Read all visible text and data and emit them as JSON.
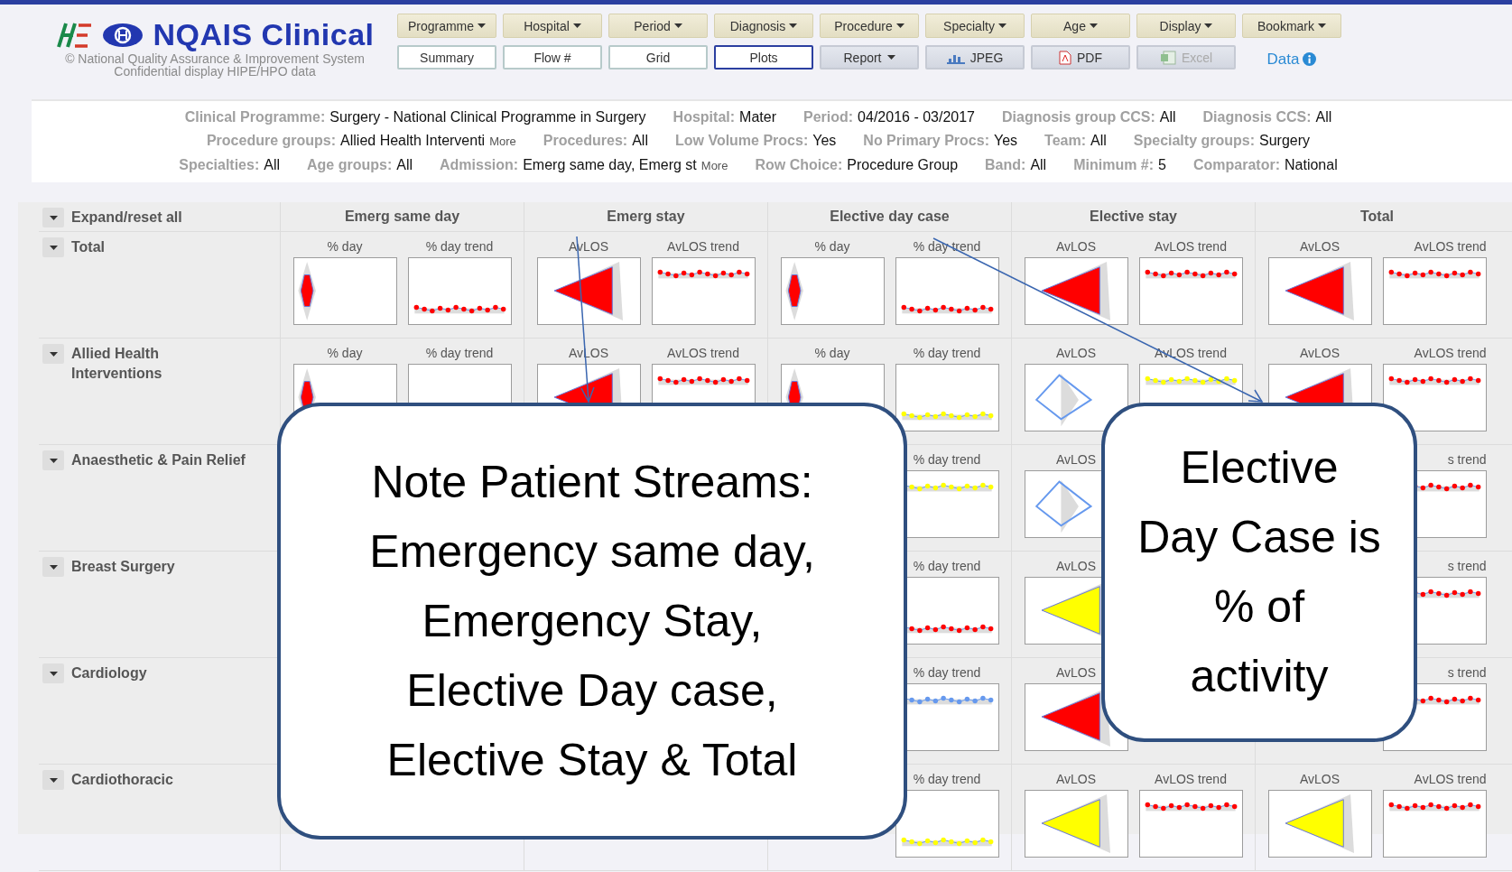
{
  "header": {
    "title": "NQAIS Clinical",
    "subtitle": [
      "© National Quality Assurance & Improvement System",
      "Confidential display HIPE/HPO data"
    ],
    "menus": [
      {
        "label": "Programme"
      },
      {
        "label": "Hospital"
      },
      {
        "label": "Period"
      },
      {
        "label": "Diagnosis"
      },
      {
        "label": "Procedure"
      },
      {
        "label": "Specialty"
      },
      {
        "label": "Age"
      },
      {
        "label": "Display"
      },
      {
        "label": "Bookmark"
      }
    ],
    "views": [
      {
        "label": "Summary",
        "kind": "view",
        "selected": false,
        "disabled": false
      },
      {
        "label": "Flow #",
        "kind": "view",
        "selected": false,
        "disabled": false
      },
      {
        "label": "Grid",
        "kind": "view",
        "selected": false,
        "disabled": false
      },
      {
        "label": "Plots",
        "kind": "view",
        "selected": true,
        "disabled": false
      },
      {
        "label": "Report",
        "kind": "menu",
        "selected": false,
        "disabled": false
      },
      {
        "label": "JPEG",
        "kind": "image",
        "selected": false,
        "disabled": false
      },
      {
        "label": "PDF",
        "kind": "pdf",
        "selected": false,
        "disabled": false
      },
      {
        "label": "Excel",
        "kind": "spreadsheet",
        "selected": false,
        "disabled": true
      }
    ],
    "data_link": "Data"
  },
  "filters": [
    [
      {
        "label": "Clinical Programme:",
        "value": "Surgery - National Clinical Programme in Surgery"
      },
      {
        "label": "Hospital:",
        "value": "Mater"
      },
      {
        "label": "Period:",
        "value": "04/2016 - 03/2017"
      },
      {
        "label": "Diagnosis group CCS:",
        "value": "All"
      },
      {
        "label": "Diagnosis CCS:",
        "value": "All"
      }
    ],
    [
      {
        "label": "Procedure groups:",
        "value": "Allied Health Interventi",
        "more": "More"
      },
      {
        "label": "Procedures:",
        "value": "All"
      },
      {
        "label": "Low Volume Procs:",
        "value": "Yes"
      },
      {
        "label": "No Primary Procs:",
        "value": "Yes"
      },
      {
        "label": "Team:",
        "value": "All"
      },
      {
        "label": "Specialty groups:",
        "value": "Surgery"
      }
    ],
    [
      {
        "label": "Specialties:",
        "value": "All"
      },
      {
        "label": "Age groups:",
        "value": "All"
      },
      {
        "label": "Admission:",
        "value": "Emerg same day, Emerg st",
        "more": "More"
      },
      {
        "label": "Row Choice:",
        "value": "Procedure Group"
      },
      {
        "label": "Band:",
        "value": "All"
      },
      {
        "label": "Minimum #:",
        "value": "5"
      },
      {
        "label": "Comparator:",
        "value": "National"
      }
    ]
  ],
  "grid": {
    "expand_label": "Expand/reset all",
    "groups": [
      "Emerg same day",
      "Emerg stay",
      "Elective day case",
      "Elective stay",
      "Total"
    ],
    "rows": [
      {
        "name": "Total",
        "plots": [
          {
            "label": "% day",
            "kind": "diamond",
            "color": "#ff0000"
          },
          {
            "label": "% day trend",
            "kind": "lowtrend",
            "color": "#ff0000"
          },
          {
            "label": "AvLOS",
            "kind": "triangle",
            "color": "#ff0000"
          },
          {
            "label": "AvLOS trend",
            "kind": "trend",
            "color": "#ff0000"
          },
          {
            "label": "% day",
            "kind": "diamond",
            "color": "#ff0000"
          },
          {
            "label": "% day trend",
            "kind": "lowtrend",
            "color": "#ff0000"
          },
          {
            "label": "AvLOS",
            "kind": "triangle",
            "color": "#ff0000"
          },
          {
            "label": "AvLOS trend",
            "kind": "trend",
            "color": "#ff0000"
          },
          {
            "label": "AvLOS",
            "kind": "triangle",
            "color": "#ff0000"
          },
          {
            "label": "AvLOS trend",
            "kind": "trend",
            "color": "#ff0000"
          }
        ]
      },
      {
        "name": "Allied Health Interventions",
        "plots": [
          {
            "label": "% day",
            "kind": "diamond",
            "color": "#ff0000"
          },
          {
            "label": "% day trend"
          },
          {
            "label": "AvLOS",
            "kind": "triangle",
            "color": "#ff0000"
          },
          {
            "label": "AvLOS trend",
            "kind": "trend",
            "color": "#ff0000"
          },
          {
            "label": "% day",
            "kind": "diamond",
            "color": "#ff0000"
          },
          {
            "label": "% day trend",
            "kind": "lowtrend",
            "color": "#ffff00"
          },
          {
            "label": "AvLOS",
            "kind": "outline",
            "color": "#6699ee"
          },
          {
            "label": "AvLOS trend",
            "kind": "trend",
            "color": "#ffff00"
          },
          {
            "label": "AvLOS",
            "kind": "triangle",
            "color": "#ff0000"
          },
          {
            "label": "AvLOS trend",
            "kind": "trend",
            "color": "#ff0000"
          }
        ]
      },
      {
        "name": "Anaesthetic & Pain Relief",
        "visible_plots": [
          {
            "label": "% day trend",
            "kind": "trend",
            "color": "#ffff00"
          },
          {
            "label": "AvLOS",
            "kind": "outline",
            "color": "#6699ee"
          }
        ],
        "edge_plots": [
          {
            "label": "s trend",
            "kind": "trend",
            "color": "#ff0000"
          }
        ]
      },
      {
        "name": "Breast Surgery",
        "visible_plots": [
          {
            "label": "% day trend",
            "kind": "lowtrend",
            "color": "#ff0000"
          },
          {
            "label": "AvLOS",
            "kind": "triangle",
            "color": "#ffff00"
          }
        ],
        "edge_plots": [
          {
            "label": "s trend",
            "kind": "trend",
            "color": "#ff0000"
          }
        ]
      },
      {
        "name": "Cardiology",
        "visible_plots": [
          {
            "label": "% day trend",
            "kind": "trend",
            "color": "#6699ee"
          },
          {
            "label": "AvLOS",
            "kind": "triangle",
            "color": "#ff0000"
          }
        ],
        "edge_plots": [
          {
            "label": "s trend",
            "kind": "trend",
            "color": "#ff0000"
          }
        ]
      },
      {
        "name": "Cardiothoracic",
        "visible_plots": [
          {
            "label": "% day trend",
            "kind": "lowtrend",
            "color": "#ffff00"
          },
          {
            "label": "AvLOS",
            "kind": "triangle",
            "color": "#ffff00"
          },
          {
            "label": "AvLOS trend",
            "kind": "trend",
            "color": "#ff0000"
          },
          {
            "label": "AvLOS",
            "kind": "triangle",
            "color": "#ffff00"
          },
          {
            "label": "AvLOS trend",
            "kind": "trend",
            "color": "#ff0000"
          }
        ]
      }
    ]
  },
  "callouts": [
    "Note Patient Streams:\nEmergency same day,\nEmergency Stay,\nElective Day case,\nElective Stay & Total",
    "Elective\nDay Case is\n% of\nactivity"
  ]
}
